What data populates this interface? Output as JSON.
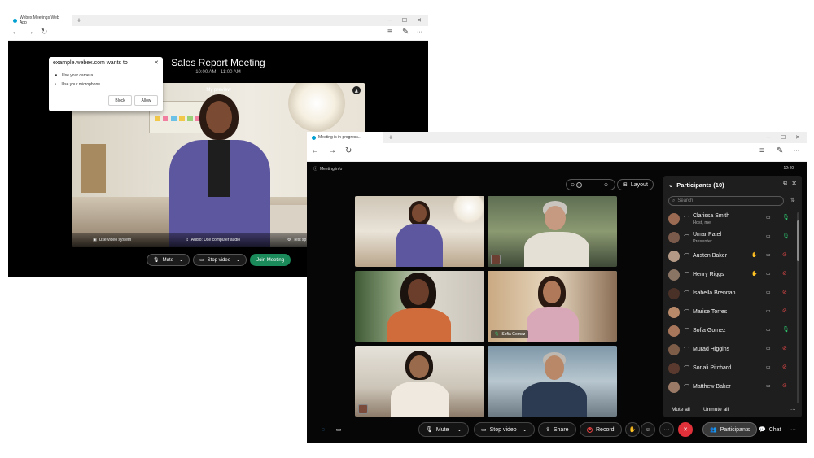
{
  "win1": {
    "tab_title": "Webex Meetings Web App",
    "new_tab": "+",
    "controls": {
      "min": "─",
      "max": "☐",
      "close": "✕"
    },
    "nav": {
      "back": "←",
      "forward": "→",
      "reload": "↻",
      "reading": "≡",
      "notes": "✎",
      "more": "···"
    },
    "meeting_title": "Sales Report Meeting",
    "meeting_time": "10:00 AM - 11:00 AM",
    "preview_label": "My preview",
    "preview_bar": {
      "video_system": "Use video system",
      "audio": "Audio: Use computer audio",
      "test": "Test sp"
    },
    "buttons": {
      "mute": "Mute",
      "stop_video": "Stop video",
      "join": "Join Meeting"
    },
    "permission": {
      "title": "example.webex.com wants to",
      "camera": "Use your camera",
      "microphone": "Use your microphone",
      "block": "Block",
      "allow": "Allow"
    }
  },
  "win2": {
    "tab_title": "Meeting is in progress...",
    "new_tab": "+",
    "meeting_info": "Meeting info",
    "clock": "12:40",
    "layout": "Layout",
    "active_speaker": "Sofia Gomez",
    "controls": {
      "mute": "Mute",
      "stop_video": "Stop video",
      "share": "Share",
      "record": "Record",
      "more": "···",
      "participants": "Participants",
      "chat": "Chat",
      "overflow": "···"
    },
    "panel": {
      "title": "Participants (10)",
      "search_placeholder": "Search",
      "mute_all": "Mute all",
      "unmute_all": "Unmute all",
      "more": "···",
      "participants": [
        {
          "name": "Clarissa Smith",
          "role": "Host, me",
          "mic": "on",
          "hand": false,
          "color": "#9b6a52"
        },
        {
          "name": "Umar Patel",
          "role": "Presenter",
          "mic": "on",
          "hand": false,
          "color": "#7a5a4a"
        },
        {
          "name": "Austen Baker",
          "role": "",
          "mic": "off",
          "hand": true,
          "color": "#b49a86"
        },
        {
          "name": "Henry Riggs",
          "role": "",
          "mic": "off",
          "hand": true,
          "color": "#8a7464"
        },
        {
          "name": "Isabella Brennan",
          "role": "",
          "mic": "off",
          "hand": false,
          "color": "#4a3128"
        },
        {
          "name": "Marise Torres",
          "role": "",
          "mic": "off",
          "hand": false,
          "color": "#b88a6a"
        },
        {
          "name": "Sofia Gomez",
          "role": "",
          "mic": "on",
          "hand": false,
          "color": "#a8765a"
        },
        {
          "name": "Murad Higgins",
          "role": "",
          "mic": "off",
          "hand": false,
          "color": "#7d5c48"
        },
        {
          "name": "Sonali Pitchard",
          "role": "",
          "mic": "off",
          "hand": false,
          "color": "#5a3a2e"
        },
        {
          "name": "Matthew Baker",
          "role": "",
          "mic": "off",
          "hand": false,
          "color": "#9a7a66"
        }
      ]
    }
  },
  "colors": {
    "accent_green": "#1a8a5a",
    "mic_on": "#2fce73",
    "mic_off": "#e54848",
    "end_red": "#e0303a",
    "active_tile": "#25b7a5"
  }
}
